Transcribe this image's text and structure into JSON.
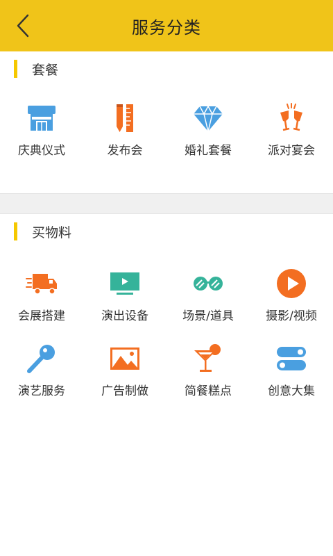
{
  "header": {
    "title": "服务分类",
    "back_icon": "chevron-left-icon"
  },
  "sections": [
    {
      "title": "套餐",
      "items": [
        {
          "label": "庆典仪式",
          "icon": "storefront-icon"
        },
        {
          "label": "发布会",
          "icon": "pen-ruler-icon"
        },
        {
          "label": "婚礼套餐",
          "icon": "diamond-icon"
        },
        {
          "label": "派对宴会",
          "icon": "cheers-glasses-icon"
        }
      ]
    },
    {
      "title": "买物料",
      "items": [
        {
          "label": "会展搭建",
          "icon": "delivery-truck-icon"
        },
        {
          "label": "演出设备",
          "icon": "tv-play-icon"
        },
        {
          "label": "场景/道具",
          "icon": "sunglasses-icon"
        },
        {
          "label": "摄影/视频",
          "icon": "play-circle-icon"
        },
        {
          "label": "演艺服务",
          "icon": "microphone-icon"
        },
        {
          "label": "广告制做",
          "icon": "picture-icon"
        },
        {
          "label": "简餐糕点",
          "icon": "cocktail-icon"
        },
        {
          "label": "创意大集",
          "icon": "toggle-stack-icon"
        }
      ]
    }
  ],
  "colors": {
    "header_bg": "#F0C419",
    "section_bar": "#F5C800",
    "blue": "#4A9FE0",
    "orange": "#F36E21",
    "teal": "#35B39A"
  }
}
